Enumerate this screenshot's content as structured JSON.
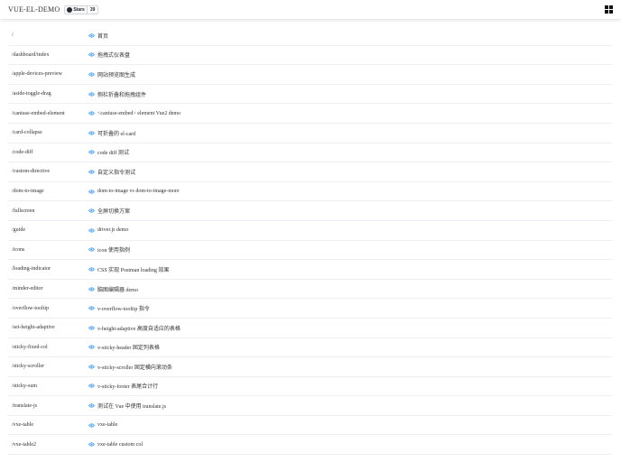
{
  "header": {
    "title": "VUE-EL-DEMO",
    "github_badge": {
      "label": "Stars",
      "count": "39",
      "icon": "github-icon"
    },
    "menu_icon": "grid-icon"
  },
  "theme": {
    "accent": "#409eff",
    "divider": "#ebeef5",
    "text": "#303133"
  },
  "routes": [
    {
      "path": "/",
      "desc": "首页"
    },
    {
      "path": "/dashboard/index",
      "desc": "拖拽式仪表盘"
    },
    {
      "path": "/apple-devices-preview",
      "desc": "网站预览图生成"
    },
    {
      "path": "/aside-toggle-drag",
      "desc": "侧栏折叠和拖拽组件"
    },
    {
      "path": "/caniuse-embed-element",
      "desc": "<caniuse-embed> element Vue2 demo"
    },
    {
      "path": "/card-collapse",
      "desc": "可折叠的 el-card"
    },
    {
      "path": "/code-diff",
      "desc": "code diff 测试"
    },
    {
      "path": "/custom-directive",
      "desc": "自定义指令测试"
    },
    {
      "path": "/dom-to-image",
      "desc": "dom-to-image vs dom-to-image-more"
    },
    {
      "path": "/fullscreen",
      "desc": "全屏切换方案"
    },
    {
      "path": "/guide",
      "desc": "driver.js demo"
    },
    {
      "path": "/icons",
      "desc": "icon 使用指例"
    },
    {
      "path": "/loading-indicator",
      "desc": "CSS 实现 Postman loading 效果"
    },
    {
      "path": "/minder-editor",
      "desc": "脑图编辑器 demo"
    },
    {
      "path": "/overflow-tooltip",
      "desc": "v-overflow-tooltip 指令"
    },
    {
      "path": "/set-height-adaptive",
      "desc": "v-height-adaptive 高度自适应的表格"
    },
    {
      "path": "/sticky-fixed-col",
      "desc": "v-sticky-header 固定列表格"
    },
    {
      "path": "/sticky-scroller",
      "desc": "v-sticky-scroller 固定横向滚动条"
    },
    {
      "path": "/sticky-sum",
      "desc": "v-sticky-footer 表尾合计行"
    },
    {
      "path": "/translate-js",
      "desc": "测试在 Vue 中使用 translate.js"
    },
    {
      "path": "/vxe-table",
      "desc": "vxe-table"
    },
    {
      "path": "/vxe-table2",
      "desc": "vxe-table custom col"
    }
  ]
}
